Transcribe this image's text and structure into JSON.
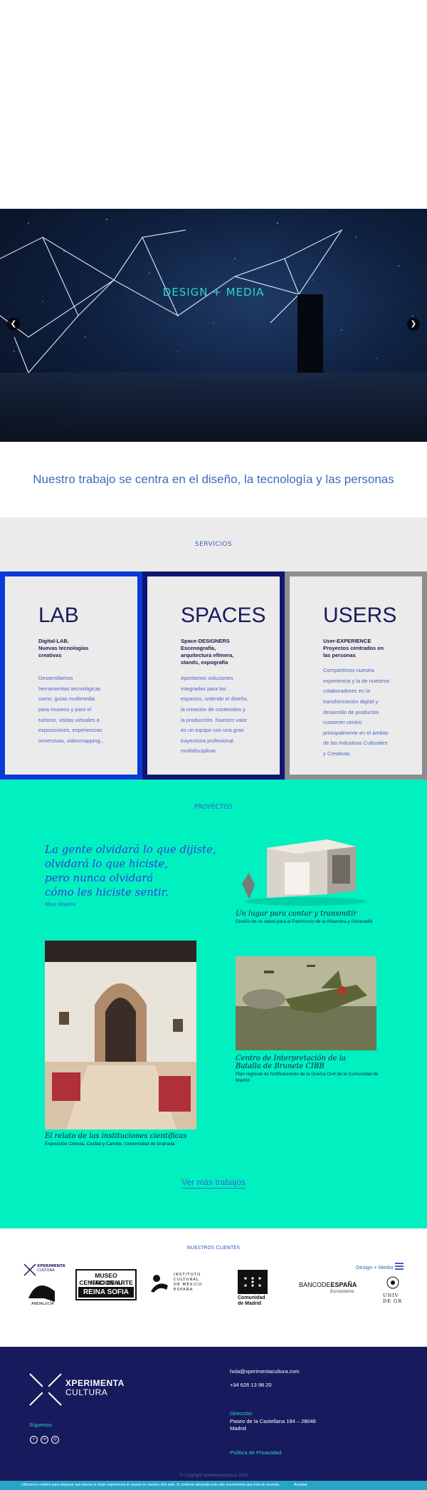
{
  "hero": {
    "title": "DESIGN + MEDIA",
    "prev_icon": "chevron-left-icon",
    "next_icon": "chevron-right-icon"
  },
  "intro": {
    "tagline": "Nuestro trabajo se centra en el diseño, la tecnología y las personas"
  },
  "services": {
    "heading": "SERVICIOS",
    "cards": [
      {
        "title": "LAB",
        "subtitle": "Digital-LAB.\nNuevas tecnologías\ncreativas",
        "description": "Desarrollamos\nherramientas tecnológicas\ncomo: guías multimedia\npara museos y para el\nturismo, visitas virtuales a\nexposiciones, experiencias\ninmersivas, videomapping...",
        "border_color": "#0a3ad8"
      },
      {
        "title": "SPACES",
        "subtitle": "Space-DESIGNERS\nEscenografía,\narquitectura efímera,\nstands, expografía",
        "description": "Aportamos soluciones\nintegradas para los\nespacios, uniendo el diseño,\nla creación de contenidos y\nla producción. Nuestro valor\nes un equipo con una gran\ntrayectoria profesional\nmultidisciplinar.",
        "border_color": "#121570"
      },
      {
        "title": "USERS",
        "subtitle": "User-EXPERIENCE\nProyectos centrados en\nlas personas",
        "description": "Compartimos nuestra\nexperiencia y la de nuestros\ncolaboradores en la\ntransformación digital y\ndesarrollo de productos\ncustomer centric\nprincipalmente en el ámbito\nde las Industrias Culturales\ny Creativas.",
        "border_color": "#8e8e8e"
      }
    ]
  },
  "projects": {
    "heading": "PROYECTOS",
    "quote": "La gente olvidará lo que dijiste,\nolvidará lo que hiciste,\npero nunca olvidará\ncómo les hiciste sentir.",
    "quote_author": "Maya Angelou",
    "items": [
      {
        "title": "Un lugar para contar y transmitir",
        "subtitle": "Diseño de un stand para el Patrimonio de la Alhambra y Generalife"
      },
      {
        "title": "El relato de las instituciones científicas",
        "subtitle": "Exposición Ciencia, Ciudad y Cambio. Universidad de Granada"
      },
      {
        "title": "Centro de Interpretación de la Batalla de Brunete CIBB",
        "subtitle": "Plan regional de fortificaciones de la Guerra Civil de la Comunidad de Madrid"
      }
    ],
    "more_label": "Ver más trabajos"
  },
  "clients": {
    "heading": "NUESTROS CLIENTES",
    "logos": [
      {
        "name": "Xperimenta Cultura Andalucía",
        "lines": [
          "XPERIMENTA",
          "CULTURA"
        ],
        "footer": "ANDALUCÍA"
      },
      {
        "name": "Museo Nacional Centro de Arte Reina Sofía",
        "lines": [
          "MUSEO NACIONAL",
          "CENTRO DE ARTE",
          "REINA SOFIA"
        ]
      },
      {
        "name": "Instituto Cultural de México en España",
        "lines": [
          "INSTITUTO",
          "CULTURAL",
          "DE MÉXICO",
          "ESPAÑA"
        ]
      },
      {
        "name": "Comunidad de Madrid",
        "lines": [
          "Comunidad",
          "de Madrid"
        ]
      },
      {
        "name": "Banco de España",
        "lines": [
          "BANCODE",
          "ESPAÑA"
        ],
        "footer": "Eurosistema"
      },
      {
        "name": "Universidad de Granada",
        "lines": [
          "UNIV",
          "DE GR"
        ]
      }
    ],
    "nav_label": "Design + Media",
    "menu_icon": "hamburger-menu-icon"
  },
  "footer": {
    "brand_line1": "XPERIMENTA",
    "brand_line2": "CULTURA",
    "email": "hola@xperimentacultura.com",
    "phone": "+34 626 13 98 20",
    "address_label": "Dirección",
    "address_line1": "Paseo de la Castellana 194 – 28046",
    "address_line2": "Madrid",
    "follow_label": "Síguenos",
    "social": [
      "twitter-icon",
      "linkedin-icon",
      "instagram-icon"
    ],
    "privacy_label": "Política de Privacidad",
    "copyright": "© Copyright xperimentacultura 2019"
  },
  "cookie": {
    "text": "Utilizamos cookies para asegurar que damos la mejor experiencia al usuario en nuestro sitio web. Si continúa utilizando este sitio asumiremos que está de acuerdo.",
    "accept_label": "Aceptar"
  },
  "colors": {
    "accent_teal": "#00f0c0",
    "brand_blue": "#0a3ad8",
    "navy": "#171a5c",
    "link_blue": "#3b6ad0"
  }
}
